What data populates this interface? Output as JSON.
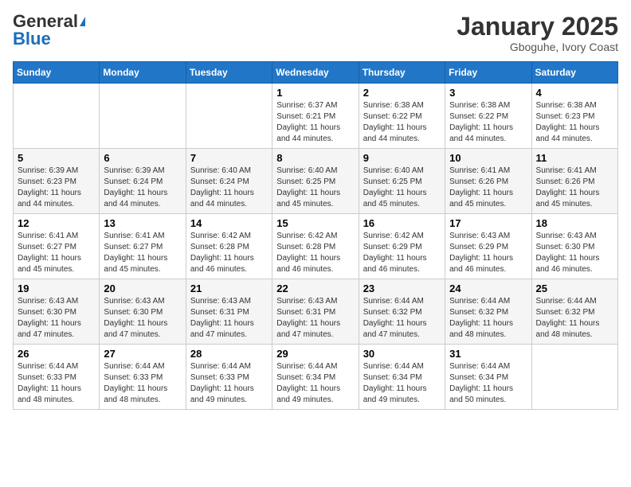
{
  "logo": {
    "general": "General",
    "blue": "Blue"
  },
  "header": {
    "month": "January 2025",
    "location": "Gboguhe, Ivory Coast"
  },
  "weekdays": [
    "Sunday",
    "Monday",
    "Tuesday",
    "Wednesday",
    "Thursday",
    "Friday",
    "Saturday"
  ],
  "weeks": [
    [
      {
        "day": "",
        "info": ""
      },
      {
        "day": "",
        "info": ""
      },
      {
        "day": "",
        "info": ""
      },
      {
        "day": "1",
        "info": "Sunrise: 6:37 AM\nSunset: 6:21 PM\nDaylight: 11 hours\nand 44 minutes."
      },
      {
        "day": "2",
        "info": "Sunrise: 6:38 AM\nSunset: 6:22 PM\nDaylight: 11 hours\nand 44 minutes."
      },
      {
        "day": "3",
        "info": "Sunrise: 6:38 AM\nSunset: 6:22 PM\nDaylight: 11 hours\nand 44 minutes."
      },
      {
        "day": "4",
        "info": "Sunrise: 6:38 AM\nSunset: 6:23 PM\nDaylight: 11 hours\nand 44 minutes."
      }
    ],
    [
      {
        "day": "5",
        "info": "Sunrise: 6:39 AM\nSunset: 6:23 PM\nDaylight: 11 hours\nand 44 minutes."
      },
      {
        "day": "6",
        "info": "Sunrise: 6:39 AM\nSunset: 6:24 PM\nDaylight: 11 hours\nand 44 minutes."
      },
      {
        "day": "7",
        "info": "Sunrise: 6:40 AM\nSunset: 6:24 PM\nDaylight: 11 hours\nand 44 minutes."
      },
      {
        "day": "8",
        "info": "Sunrise: 6:40 AM\nSunset: 6:25 PM\nDaylight: 11 hours\nand 45 minutes."
      },
      {
        "day": "9",
        "info": "Sunrise: 6:40 AM\nSunset: 6:25 PM\nDaylight: 11 hours\nand 45 minutes."
      },
      {
        "day": "10",
        "info": "Sunrise: 6:41 AM\nSunset: 6:26 PM\nDaylight: 11 hours\nand 45 minutes."
      },
      {
        "day": "11",
        "info": "Sunrise: 6:41 AM\nSunset: 6:26 PM\nDaylight: 11 hours\nand 45 minutes."
      }
    ],
    [
      {
        "day": "12",
        "info": "Sunrise: 6:41 AM\nSunset: 6:27 PM\nDaylight: 11 hours\nand 45 minutes."
      },
      {
        "day": "13",
        "info": "Sunrise: 6:41 AM\nSunset: 6:27 PM\nDaylight: 11 hours\nand 45 minutes."
      },
      {
        "day": "14",
        "info": "Sunrise: 6:42 AM\nSunset: 6:28 PM\nDaylight: 11 hours\nand 46 minutes."
      },
      {
        "day": "15",
        "info": "Sunrise: 6:42 AM\nSunset: 6:28 PM\nDaylight: 11 hours\nand 46 minutes."
      },
      {
        "day": "16",
        "info": "Sunrise: 6:42 AM\nSunset: 6:29 PM\nDaylight: 11 hours\nand 46 minutes."
      },
      {
        "day": "17",
        "info": "Sunrise: 6:43 AM\nSunset: 6:29 PM\nDaylight: 11 hours\nand 46 minutes."
      },
      {
        "day": "18",
        "info": "Sunrise: 6:43 AM\nSunset: 6:30 PM\nDaylight: 11 hours\nand 46 minutes."
      }
    ],
    [
      {
        "day": "19",
        "info": "Sunrise: 6:43 AM\nSunset: 6:30 PM\nDaylight: 11 hours\nand 47 minutes."
      },
      {
        "day": "20",
        "info": "Sunrise: 6:43 AM\nSunset: 6:30 PM\nDaylight: 11 hours\nand 47 minutes."
      },
      {
        "day": "21",
        "info": "Sunrise: 6:43 AM\nSunset: 6:31 PM\nDaylight: 11 hours\nand 47 minutes."
      },
      {
        "day": "22",
        "info": "Sunrise: 6:43 AM\nSunset: 6:31 PM\nDaylight: 11 hours\nand 47 minutes."
      },
      {
        "day": "23",
        "info": "Sunrise: 6:44 AM\nSunset: 6:32 PM\nDaylight: 11 hours\nand 47 minutes."
      },
      {
        "day": "24",
        "info": "Sunrise: 6:44 AM\nSunset: 6:32 PM\nDaylight: 11 hours\nand 48 minutes."
      },
      {
        "day": "25",
        "info": "Sunrise: 6:44 AM\nSunset: 6:32 PM\nDaylight: 11 hours\nand 48 minutes."
      }
    ],
    [
      {
        "day": "26",
        "info": "Sunrise: 6:44 AM\nSunset: 6:33 PM\nDaylight: 11 hours\nand 48 minutes."
      },
      {
        "day": "27",
        "info": "Sunrise: 6:44 AM\nSunset: 6:33 PM\nDaylight: 11 hours\nand 48 minutes."
      },
      {
        "day": "28",
        "info": "Sunrise: 6:44 AM\nSunset: 6:33 PM\nDaylight: 11 hours\nand 49 minutes."
      },
      {
        "day": "29",
        "info": "Sunrise: 6:44 AM\nSunset: 6:34 PM\nDaylight: 11 hours\nand 49 minutes."
      },
      {
        "day": "30",
        "info": "Sunrise: 6:44 AM\nSunset: 6:34 PM\nDaylight: 11 hours\nand 49 minutes."
      },
      {
        "day": "31",
        "info": "Sunrise: 6:44 AM\nSunset: 6:34 PM\nDaylight: 11 hours\nand 50 minutes."
      },
      {
        "day": "",
        "info": ""
      }
    ]
  ]
}
